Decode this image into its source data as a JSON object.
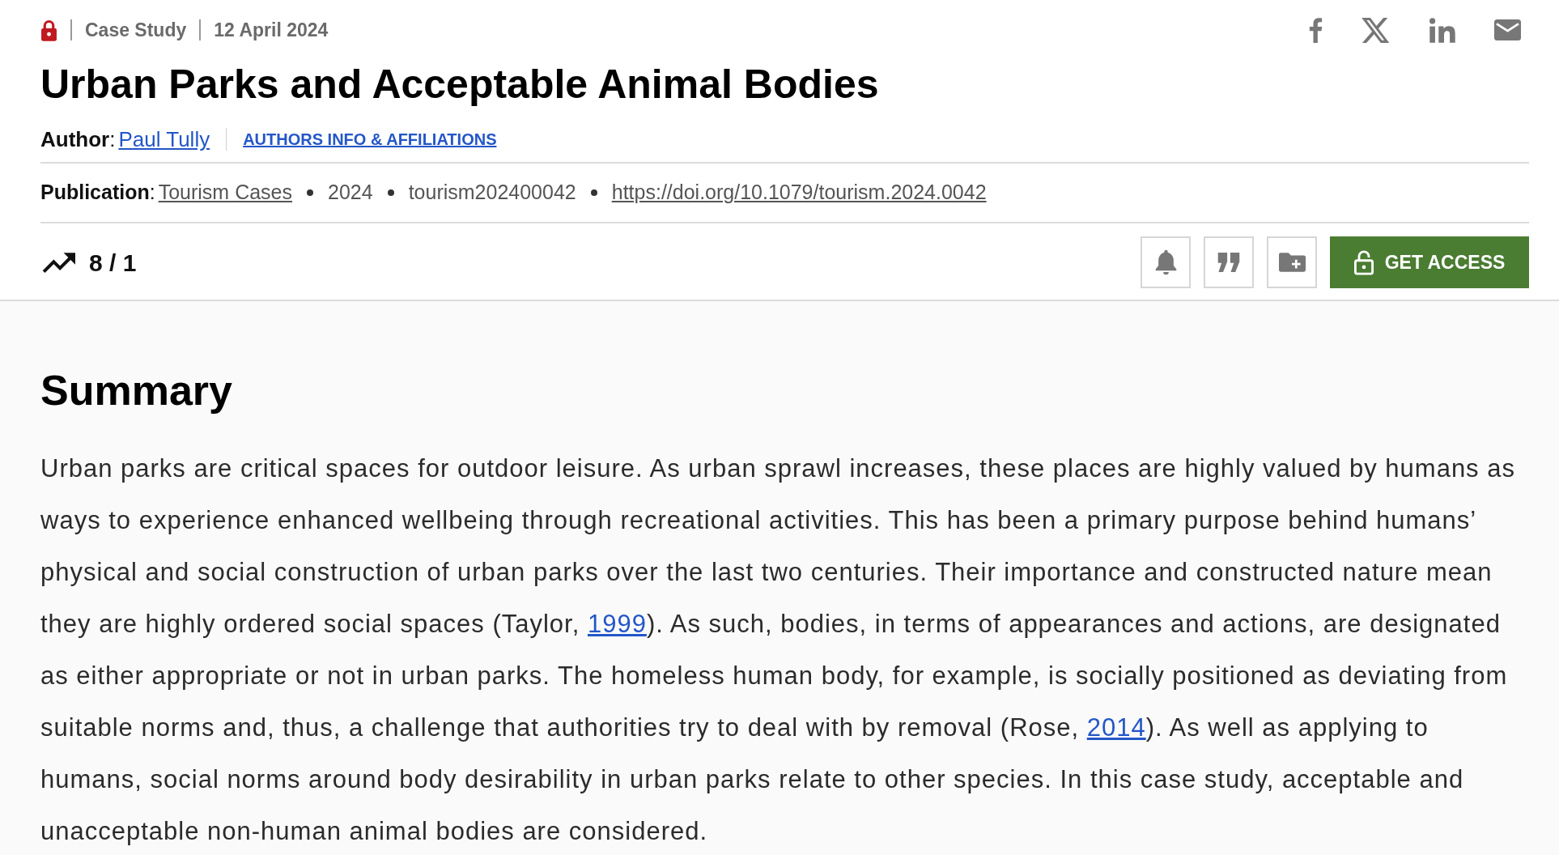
{
  "article_header": {
    "type": "Case Study",
    "date": "12 April 2024",
    "title": "Urban Parks and Acceptable Animal Bodies",
    "author": {
      "label": "**Author**:",
      "name": "Paul Tully",
      "info_link": "AUTHORS INFO & AFFILIATIONS"
    },
    "publication": {
      "label": "**Publication**:",
      "items": [
        {
          "kind": "link",
          "text": "Tourism Cases"
        },
        {
          "kind": "text",
          "text": "2024"
        },
        {
          "kind": "text",
          "text": "tourism202400042"
        },
        {
          "kind": "link",
          "text": "https://doi.org/10.1079/tourism.2024.0042"
        }
      ]
    },
    "toolbar": {
      "metrics": "8 / 1",
      "access_button": "GET ACCESS"
    }
  },
  "summary": {
    "heading": "Summary",
    "paragraph": [
      {
        "kind": "text",
        "text": "Urban parks are critical spaces for outdoor leisure. As urban sprawl increases, these places are highly valued by humans as ways to experience enhanced wellbeing through recreational activities. This has been a primary purpose behind humans’ physical and social construction of urban parks over the last two centuries. Their importance and constructed nature mean they are highly ordered social spaces (Taylor, "
      },
      {
        "kind": "link",
        "text": "1999"
      },
      {
        "kind": "text",
        "text": "). As such, bodies, in terms of appearances and actions, are designated as either appropriate or not in urban parks. The homeless human body, for example, is socially positioned as deviating from suitable norms and, thus, a challenge that authorities try to deal with by removal (Rose, "
      },
      {
        "kind": "link",
        "text": "2014"
      },
      {
        "kind": "text",
        "text": "). As well as applying to humans, social norms around body desirability in urban parks relate to other species. In this case study, acceptable and unacceptable non-human animal bodies are considered."
      }
    ]
  }
}
